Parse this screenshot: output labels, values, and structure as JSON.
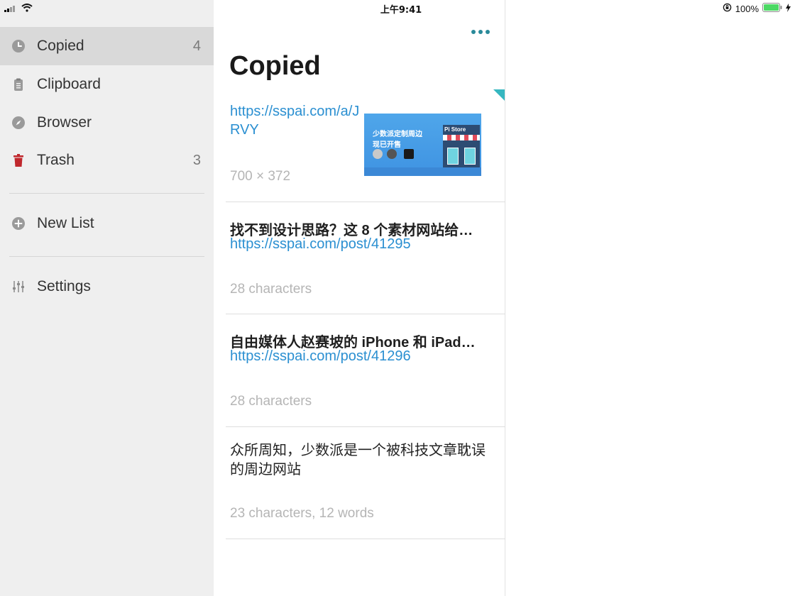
{
  "status_bar": {
    "time": "上午9:41",
    "battery_text": "100%"
  },
  "sidebar": {
    "items": [
      {
        "label": "Copied",
        "count": "4",
        "icon": "clock-icon"
      },
      {
        "label": "Clipboard",
        "count": "",
        "icon": "clipboard-icon"
      },
      {
        "label": "Browser",
        "count": "",
        "icon": "compass-icon"
      },
      {
        "label": "Trash",
        "count": "3",
        "icon": "trash-icon"
      }
    ],
    "new_list": {
      "label": "New List",
      "icon": "plus-circle-icon"
    },
    "settings": {
      "label": "Settings",
      "icon": "sliders-icon"
    }
  },
  "list": {
    "title": "Copied",
    "entries": [
      {
        "url": "https://sspai.com/a/J",
        "url_cont": "RVY",
        "meta": "700 × 372",
        "thumb_line1": "少数派定制周边",
        "thumb_line2": "现已开售",
        "thumb_sign": "Pi Store"
      },
      {
        "title": "找不到设计思路？这 8 个素材网站给…",
        "url": "https://sspai.com/post/41295",
        "meta": "28 characters"
      },
      {
        "title": "自由媒体人赵赛坡的 iPhone 和 iPad…",
        "url": "https://sspai.com/post/41296",
        "meta": "28 characters"
      },
      {
        "text": "众所周知，少数派是一个被科技文章耽误的周边网站",
        "meta": "23 characters, 12 words"
      }
    ]
  },
  "colors": {
    "accent": "#2a8fd1",
    "teal": "#2a8a9a",
    "trash_red": "#c0282d",
    "battery_green": "#4cd964"
  }
}
